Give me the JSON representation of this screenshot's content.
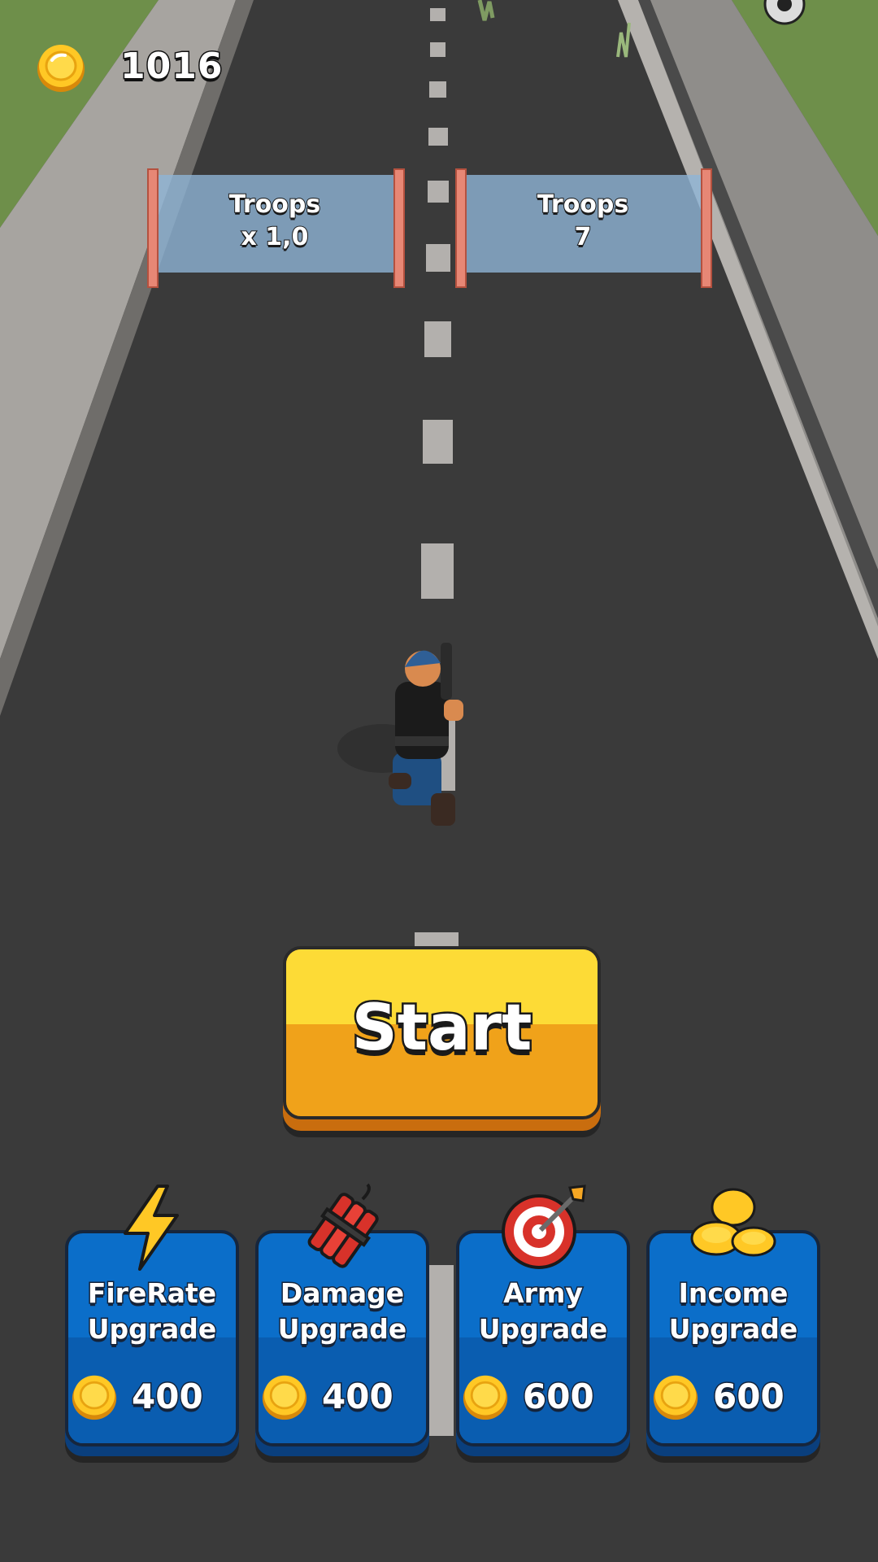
{
  "hud": {
    "coins": "1016"
  },
  "gates": [
    {
      "line1": "Troops",
      "line2": "x 1,0"
    },
    {
      "line1": "Troops",
      "line2": "7"
    }
  ],
  "start_label": "Start",
  "upgrades": [
    {
      "line1": "FireRate",
      "line2": "Upgrade",
      "price": "400",
      "icon": "lightning-icon"
    },
    {
      "line1": "Damage",
      "line2": "Upgrade",
      "price": "400",
      "icon": "dynamite-icon"
    },
    {
      "line1": "Army",
      "line2": "Upgrade",
      "price": "600",
      "icon": "target-icon"
    },
    {
      "line1": "Income",
      "line2": "Upgrade",
      "price": "600",
      "icon": "coin-stack-icon"
    }
  ],
  "colors": {
    "road": "#3a3a3a",
    "grass": "#6e8f4a",
    "start_button": "#fddb36",
    "card": "#0b6ec9",
    "gate": "#8fb4d6"
  }
}
